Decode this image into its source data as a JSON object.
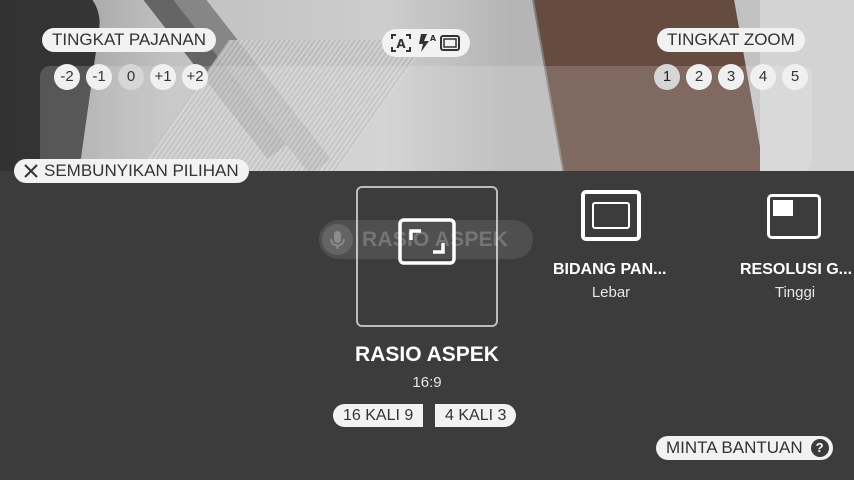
{
  "exposure": {
    "label": "TINGKAT PAJANAN",
    "levels": [
      "-2",
      "-1",
      "0",
      "+1",
      "+2"
    ]
  },
  "zoom": {
    "label": "TINGKAT ZOOM",
    "levels": [
      "1",
      "2",
      "3",
      "4",
      "5"
    ]
  },
  "top_icons": [
    "auto-scene-icon",
    "flash-auto-icon",
    "aspect-frame-icon"
  ],
  "hide_options_label": "SEMBUNYIKAN PILIHAN",
  "voice_hint": "RASIO ASPEK",
  "selected_option": {
    "title": "RASIO ASPEK",
    "value": "16:9",
    "choices": [
      "16 KALI 9",
      "4 KALI 3"
    ]
  },
  "options": [
    {
      "title": "BIDANG PAN...",
      "value": "Lebar",
      "icon": "wide-field-icon"
    },
    {
      "title": "RESOLUSI G...",
      "value": "Tinggi",
      "icon": "resolution-icon"
    }
  ],
  "help_label": "MINTA BANTUAN",
  "help_icon": "?"
}
